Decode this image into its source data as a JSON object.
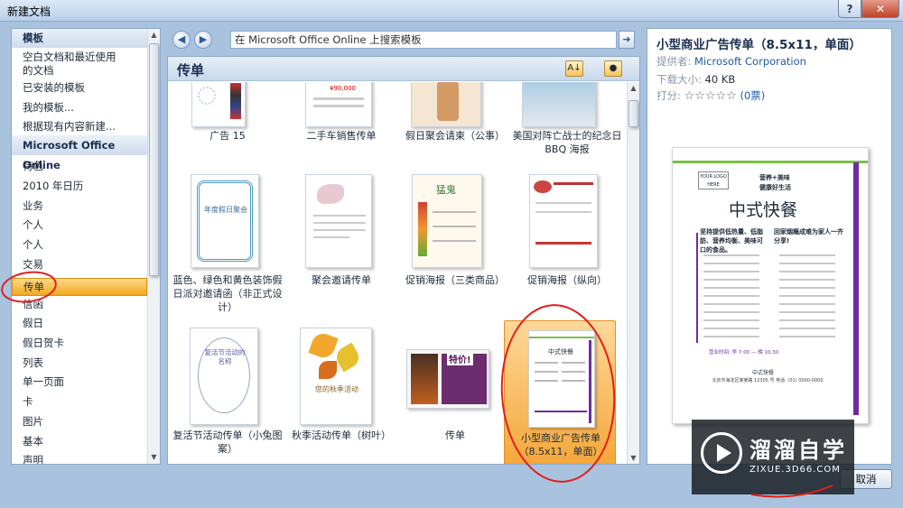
{
  "window": {
    "title": "新建文档",
    "help_label": "?",
    "close_label": "✕"
  },
  "left_panel": {
    "items": [
      {
        "label": "模板",
        "type": "header"
      },
      {
        "label": "空白文档和最近使用",
        "type": "item"
      },
      {
        "label": "的文档",
        "type": "item"
      },
      {
        "label": "已安装的模板",
        "type": "item"
      },
      {
        "label": "我的模板...",
        "type": "item"
      },
      {
        "label": "根据现有内容新建...",
        "type": "item"
      },
      {
        "label": "Microsoft Office Online",
        "type": "header"
      },
      {
        "label": "特色",
        "type": "item"
      },
      {
        "label": "2010 年日历",
        "type": "item"
      },
      {
        "label": "业务",
        "type": "item"
      },
      {
        "label": "个人",
        "type": "item"
      },
      {
        "label": "个人",
        "type": "item"
      },
      {
        "label": "交易",
        "type": "item"
      },
      {
        "label": "传单",
        "type": "selected"
      },
      {
        "label": "信函",
        "type": "item"
      },
      {
        "label": "假日",
        "type": "item"
      },
      {
        "label": "假日贺卡",
        "type": "item"
      },
      {
        "label": "列表",
        "type": "item"
      },
      {
        "label": "单一页面",
        "type": "item"
      },
      {
        "label": "卡",
        "type": "item"
      },
      {
        "label": "图片",
        "type": "item"
      },
      {
        "label": "基本",
        "type": "item"
      },
      {
        "label": "声明",
        "type": "item"
      }
    ]
  },
  "navbar": {
    "back_icon": "back-arrow-icon",
    "forward_icon": "forward-arrow-icon",
    "search_value": "在 Microsoft Office Online 上搜索模板",
    "go_icon": "go-arrow-icon"
  },
  "center": {
    "title": "传单",
    "tiles": [
      {
        "label": "广告 15"
      },
      {
        "label": "二手车销售传单"
      },
      {
        "label": "假日聚会请柬（公事）"
      },
      {
        "label": "美国对阵亡战士的纪念日 BBQ 海报"
      },
      {
        "label": "蓝色、绿色和黄色装饰假日派对邀请函（非正式设计）"
      },
      {
        "label": "聚会邀请传单"
      },
      {
        "label": "促销海报（三类商品）"
      },
      {
        "label": "促销海报（纵向）"
      },
      {
        "label": "复活节活动传单（小兔图案）"
      },
      {
        "label": "秋季活动传单（树叶）"
      },
      {
        "label": "传单"
      },
      {
        "label": "小型商业广告传单（8.5x11，单面）"
      }
    ],
    "thumb_text": {
      "car_price": "¥90,000",
      "holiday_party": "年度假日聚会",
      "easter": "复活节活动的名称",
      "autumn": "您的秋季活动",
      "sale": "特价!",
      "chinese_fast_food": "中式快餐"
    }
  },
  "preview": {
    "title": "小型商业广告传单（8.5x11，单面）",
    "provider_label": "提供者:",
    "provider_value": "Microsoft Corporation",
    "size_label": "下载大小:",
    "size_value": "40 KB",
    "rating_label": "打分:",
    "stars": "☆☆☆☆☆",
    "votes": "(0票)",
    "doc": {
      "logo": "YOUR LOGO HERE",
      "tagline_1": "营养+美味",
      "tagline_2": "健康好生活",
      "heading": "中式快餐",
      "left_head": "坚持提供低热量、低脂肪、营养均衡、美味可口的食品。",
      "right_head": "回家烟瘾成难为家人一齐分享!",
      "hours": "营业时间: 早 7:00 — 晚 10:30",
      "shop_name": "中式快餐",
      "address": "北京市海淀区某某路 12305 号 电话: (01) 0000-0000"
    }
  },
  "buttons": {
    "cancel_label": "取消"
  },
  "watermark": {
    "brand": "溜溜自学",
    "url": "ZIXUE.3D66.COM"
  }
}
